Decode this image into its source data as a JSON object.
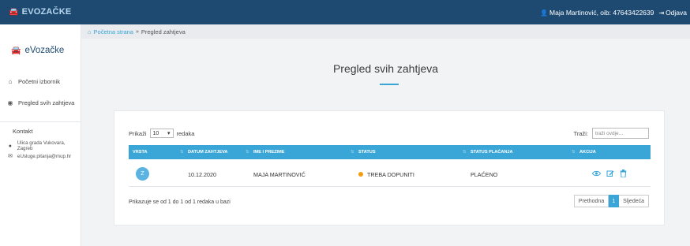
{
  "topbar": {
    "brand": "EVOZAČKE",
    "user": "Maja Martinović, oib: 47643422639",
    "logout": "Odjava"
  },
  "sidebar": {
    "brand": "eVozačke",
    "items": [
      {
        "label": "Početni izbornik"
      },
      {
        "label": "Pregled svih zahtjeva"
      }
    ],
    "contact_title": "Kontakt",
    "contact": [
      {
        "text": "Ulica grada Vukovara, Zagreb"
      },
      {
        "text": "eUsluge.pitanja@mup.hr"
      }
    ]
  },
  "breadcrumb": {
    "home": "Početna strana",
    "separator": "»",
    "current": "Pregled zahtjeva"
  },
  "page": {
    "title": "Pregled svih zahtjeva"
  },
  "table_controls": {
    "show_label": "Prikaži",
    "page_size": "10",
    "entries_label": "redaka",
    "search_label": "Traži:",
    "search_placeholder": "traži ovdje..."
  },
  "table": {
    "columns": [
      "VRSTA",
      "DATUM ZAHTJEVA",
      "IME I PREZIME",
      "STATUS",
      "STATUS PLAĆANJA",
      "AKCIJA"
    ],
    "rows": [
      {
        "type": "Z",
        "date": "10.12.2020",
        "name": "MAJA MARTINOVIĆ",
        "status": "TREBA DOPUNITI",
        "payment": "PLAĆENO"
      }
    ]
  },
  "footer": {
    "info": "Prikazuje se od 1 do 1 od 1 redaka u bazi",
    "prev": "Prethodna",
    "page": "1",
    "next": "Sljedeća"
  },
  "colors": {
    "topbar": "#1e4a72",
    "accent": "#3aa6d8",
    "status_dot": "#f39c12"
  }
}
